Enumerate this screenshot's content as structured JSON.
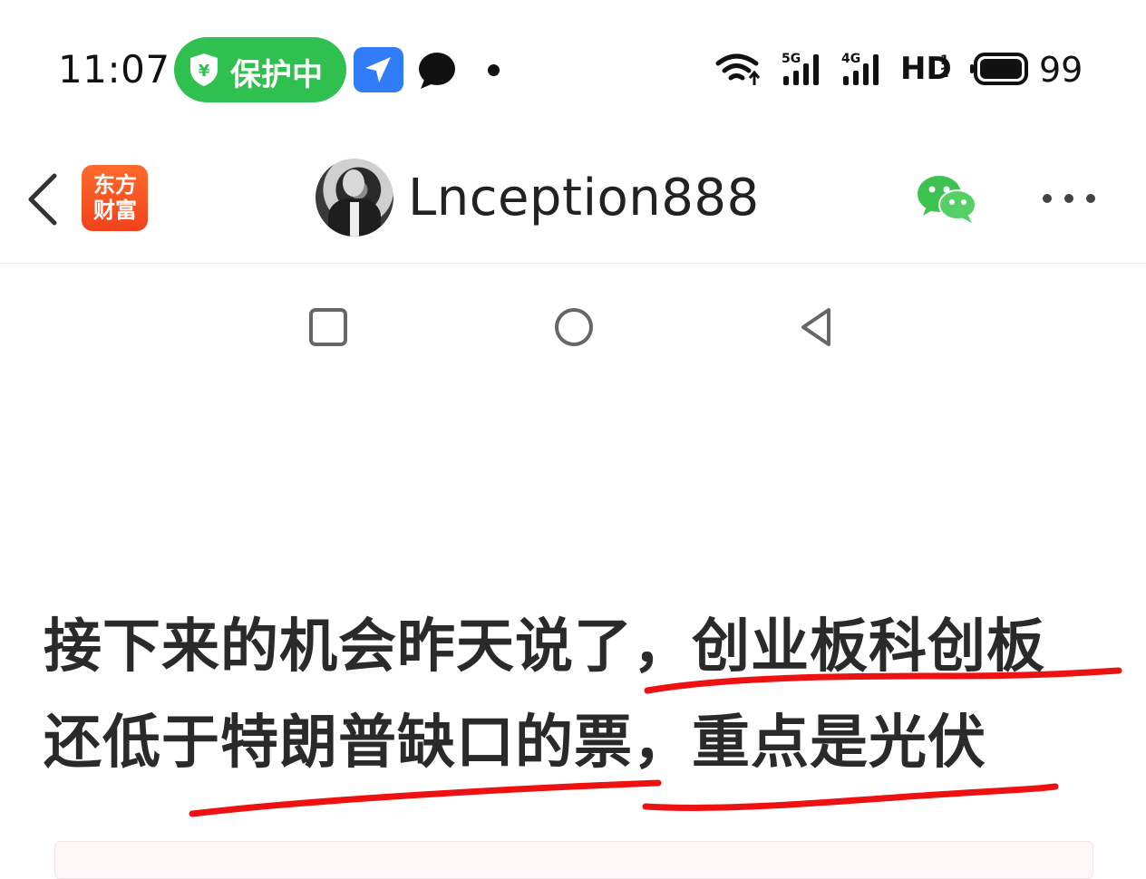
{
  "status_bar": {
    "time": "11:07",
    "protection_label": "保护中",
    "protection_color": "#2fc050",
    "network1": "5G",
    "network2": "4G",
    "hd_label": "HD",
    "hd_sub1": "1",
    "hd_sub2": "2",
    "battery": "99",
    "icons": [
      "shield-yuan-icon",
      "navigation-arrow-icon",
      "chat-bubble-icon",
      "dot-icon",
      "wifi-icon",
      "signal-icon",
      "signal-icon",
      "battery-icon"
    ]
  },
  "header": {
    "back_icon": "chevron-left-icon",
    "app_logo_line1": "东方",
    "app_logo_line2": "财富",
    "app_logo_color": "#f2421d",
    "username": "Lnception888",
    "share_icon": "wechat-icon",
    "more_icon": "more-horizontal-icon"
  },
  "system_keys": [
    "recent-apps-icon",
    "home-icon",
    "back-triangle-icon"
  ],
  "post": {
    "line1_plain": "接下来的机会昨天说了，",
    "line1_marked": "创业板科创板",
    "line2_marked_a": "还低于特朗普缺口的票",
    "line2_comma": "，",
    "line2_marked_b": "重点是光伏",
    "underline_color": "#ee1111"
  }
}
